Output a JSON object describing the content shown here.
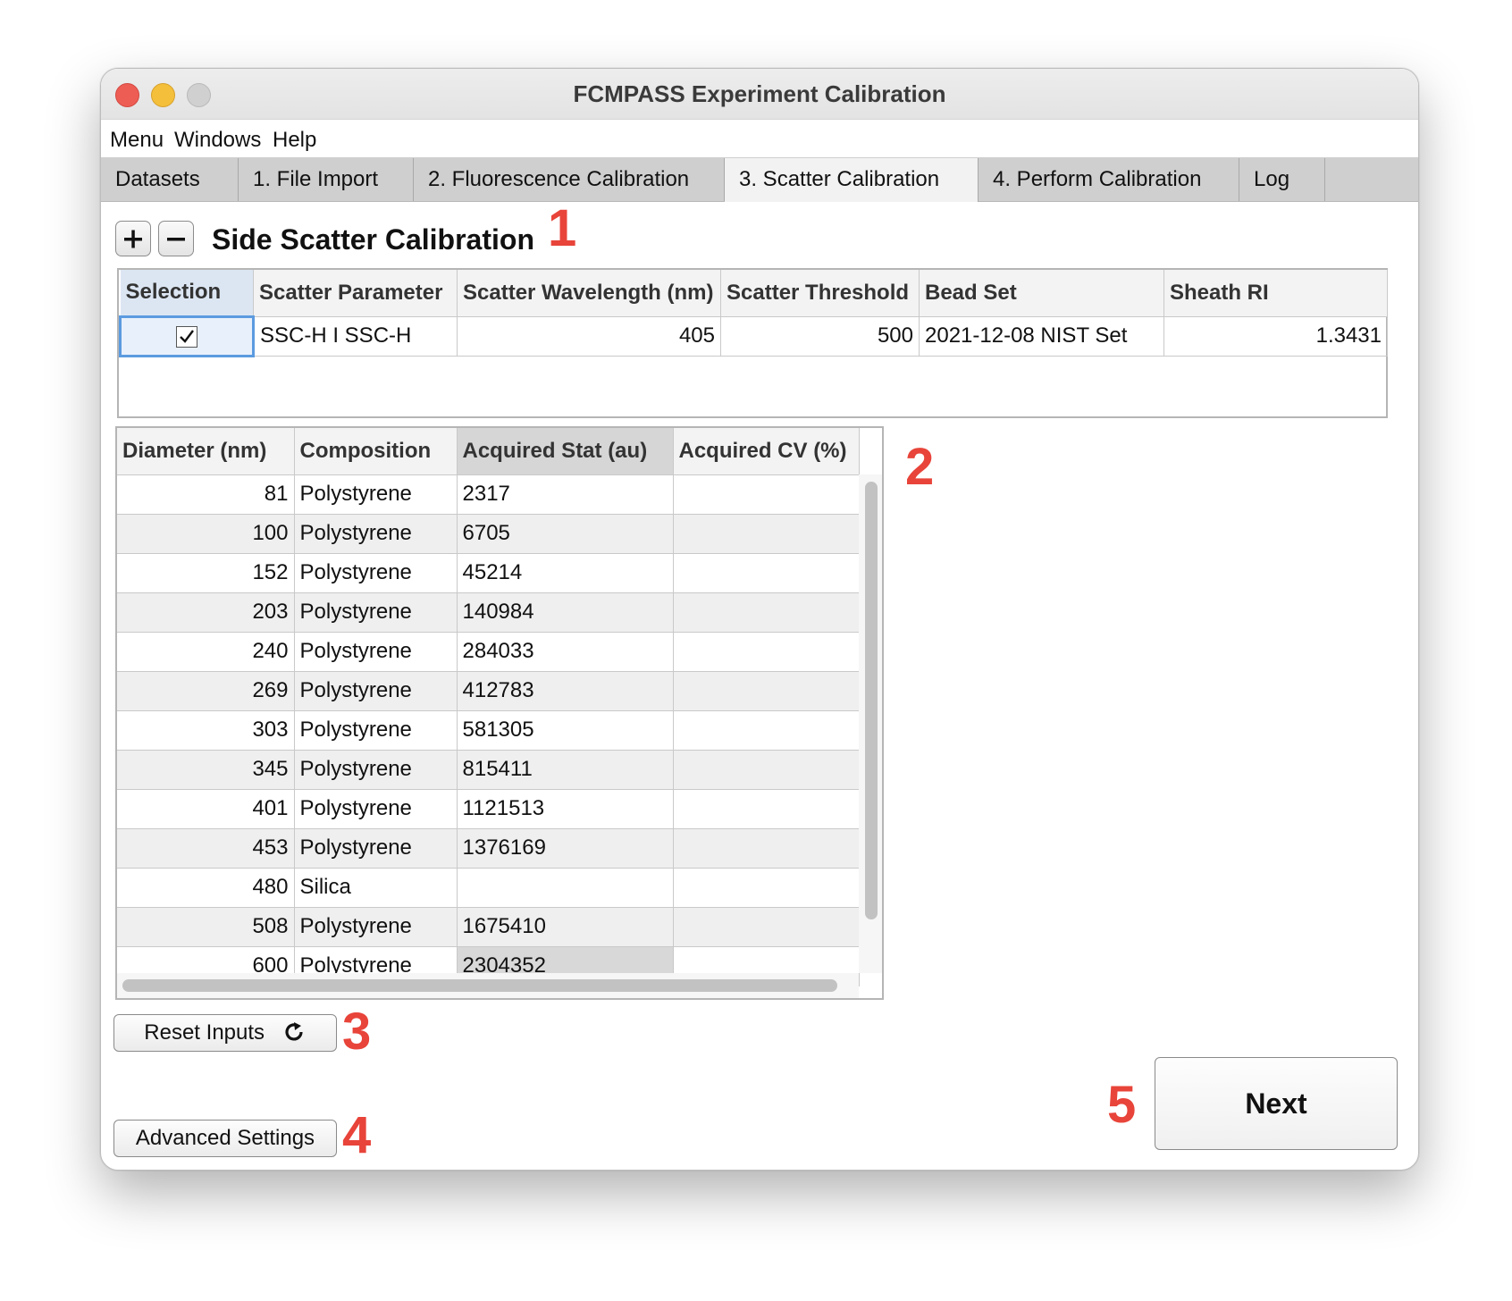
{
  "window": {
    "title": "FCMPASS Experiment Calibration"
  },
  "menubar": {
    "items": [
      "Menu",
      "Windows",
      "Help"
    ]
  },
  "tabs": [
    {
      "label": "Datasets"
    },
    {
      "label": "1. File Import"
    },
    {
      "label": "2. Fluorescence Calibration"
    },
    {
      "label": "3. Scatter Calibration"
    },
    {
      "label": "4. Perform Calibration"
    },
    {
      "label": "Log"
    }
  ],
  "active_tab": "3. Scatter Calibration",
  "section": {
    "title": "Side Scatter Calibration",
    "add_icon": "plus-icon",
    "remove_icon": "minus-icon"
  },
  "annotations": [
    "1",
    "2",
    "3",
    "4",
    "5"
  ],
  "scatter_table": {
    "headers": [
      "Selection",
      "Scatter Parameter",
      "Scatter Wavelength (nm)",
      "Scatter Threshold",
      "Bead Set",
      "Sheath RI"
    ],
    "rows": [
      {
        "selected": true,
        "parameter": "SSC-H I SSC-H",
        "wavelength": "405",
        "threshold": "500",
        "bead_set": "2021-12-08 NIST Set",
        "sheath_ri": "1.3431"
      }
    ]
  },
  "bead_table": {
    "headers": [
      "Diameter (nm)",
      "Composition",
      "Acquired Stat (au)",
      "Acquired CV (%)"
    ],
    "rows": [
      {
        "diameter": "81",
        "composition": "Polystyrene",
        "stat": "2317",
        "cv": ""
      },
      {
        "diameter": "100",
        "composition": "Polystyrene",
        "stat": "6705",
        "cv": ""
      },
      {
        "diameter": "152",
        "composition": "Polystyrene",
        "stat": "45214",
        "cv": ""
      },
      {
        "diameter": "203",
        "composition": "Polystyrene",
        "stat": "140984",
        "cv": ""
      },
      {
        "diameter": "240",
        "composition": "Polystyrene",
        "stat": "284033",
        "cv": ""
      },
      {
        "diameter": "269",
        "composition": "Polystyrene",
        "stat": "412783",
        "cv": ""
      },
      {
        "diameter": "303",
        "composition": "Polystyrene",
        "stat": "581305",
        "cv": ""
      },
      {
        "diameter": "345",
        "composition": "Polystyrene",
        "stat": "815411",
        "cv": ""
      },
      {
        "diameter": "401",
        "composition": "Polystyrene",
        "stat": "1121513",
        "cv": ""
      },
      {
        "diameter": "453",
        "composition": "Polystyrene",
        "stat": "1376169",
        "cv": ""
      },
      {
        "diameter": "480",
        "composition": "Silica",
        "stat": "",
        "cv": ""
      },
      {
        "diameter": "508",
        "composition": "Polystyrene",
        "stat": "1675410",
        "cv": ""
      },
      {
        "diameter": "600",
        "composition": "Polystyrene",
        "stat": "2304352",
        "cv": ""
      }
    ]
  },
  "buttons": {
    "reset": "Reset Inputs",
    "reset_icon": "refresh-icon",
    "advanced": "Advanced Settings",
    "next": "Next"
  },
  "colors": {
    "annotation": "#e8443a",
    "close": "#ee5d54",
    "minimize": "#f4bf3a",
    "selection_border": "#5b9be0"
  }
}
